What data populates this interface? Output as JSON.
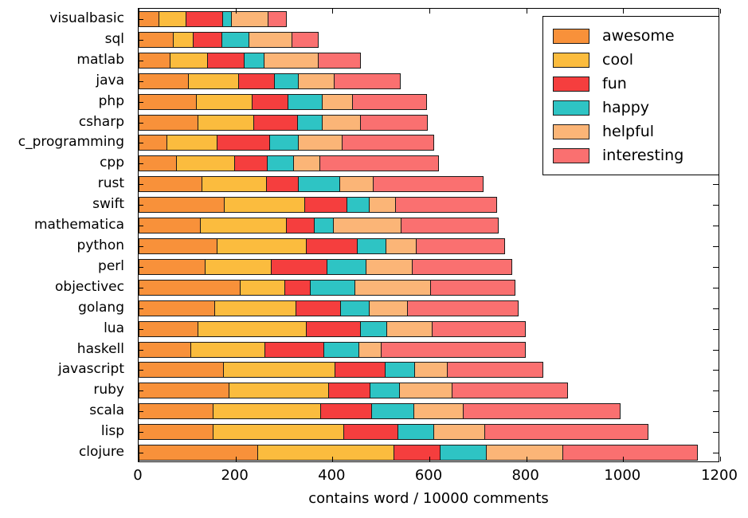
{
  "chart_data": {
    "type": "bar",
    "orientation": "horizontal",
    "stacked": true,
    "title": "",
    "xlabel": "contains word / 10000 comments",
    "ylabel": "",
    "xlim": [
      0,
      1200
    ],
    "xticks": [
      0,
      200,
      400,
      600,
      800,
      1000,
      1200
    ],
    "xticklabels": [
      "0",
      "200",
      "400",
      "600",
      "800",
      "1000",
      "1200"
    ],
    "grid": false,
    "legend_position": "upper right",
    "categories": [
      "visualbasic",
      "sql",
      "matlab",
      "java",
      "php",
      "csharp",
      "c_programming",
      "cpp",
      "rust",
      "swift",
      "mathematica",
      "python",
      "perl",
      "objectivec",
      "golang",
      "lua",
      "haskell",
      "javascript",
      "ruby",
      "scala",
      "lisp",
      "clojure"
    ],
    "series": [
      {
        "name": "awesome",
        "color": "#F8913A",
        "values": [
          41,
          71,
          64,
          102,
          118,
          122,
          57,
          77,
          130,
          176,
          127,
          161,
          136,
          209,
          156,
          122,
          107,
          175,
          185,
          153,
          153,
          245
        ]
      },
      {
        "name": "cool",
        "color": "#FBBC3E",
        "values": [
          56,
          41,
          77,
          104,
          115,
          115,
          104,
          120,
          133,
          166,
          177,
          184,
          137,
          92,
          168,
          223,
          152,
          229,
          207,
          222,
          269,
          281
        ]
      },
      {
        "name": "fun",
        "color": "#F53E3E",
        "values": [
          76,
          59,
          76,
          73,
          74,
          90,
          108,
          68,
          66,
          87,
          58,
          105,
          115,
          52,
          92,
          112,
          122,
          104,
          85,
          105,
          113,
          95
        ]
      },
      {
        "name": "happy",
        "color": "#2EC4C4",
        "values": [
          18,
          56,
          41,
          50,
          71,
          51,
          60,
          54,
          85,
          46,
          39,
          60,
          81,
          93,
          59,
          54,
          72,
          60,
          61,
          87,
          73,
          96
        ]
      },
      {
        "name": "helpful",
        "color": "#FBB577",
        "values": [
          75,
          89,
          112,
          74,
          62,
          79,
          90,
          54,
          69,
          54,
          140,
          62,
          95,
          156,
          79,
          94,
          47,
          68,
          108,
          102,
          105,
          158
        ]
      },
      {
        "name": "interesting",
        "color": "#FA7070",
        "values": [
          38,
          54,
          87,
          136,
          152,
          138,
          189,
          244,
          227,
          209,
          199,
          182,
          204,
          174,
          227,
          191,
          296,
          196,
          238,
          324,
          336,
          276
        ]
      }
    ],
    "totals": [
      304,
      370,
      457,
      539,
      592,
      595,
      608,
      617,
      710,
      738,
      740,
      754,
      768,
      776,
      781,
      796,
      796,
      832,
      884,
      993,
      1049,
      1151
    ]
  },
  "legend": {
    "entries": [
      {
        "label": "awesome",
        "color": "#F8913A"
      },
      {
        "label": "cool",
        "color": "#FBBC3E"
      },
      {
        "label": "fun",
        "color": "#F53E3E"
      },
      {
        "label": "happy",
        "color": "#2EC4C4"
      },
      {
        "label": "helpful",
        "color": "#FBB577"
      },
      {
        "label": "interesting",
        "color": "#FA7070"
      }
    ]
  },
  "axes": {
    "x_title": "contains word / 10000 comments"
  }
}
